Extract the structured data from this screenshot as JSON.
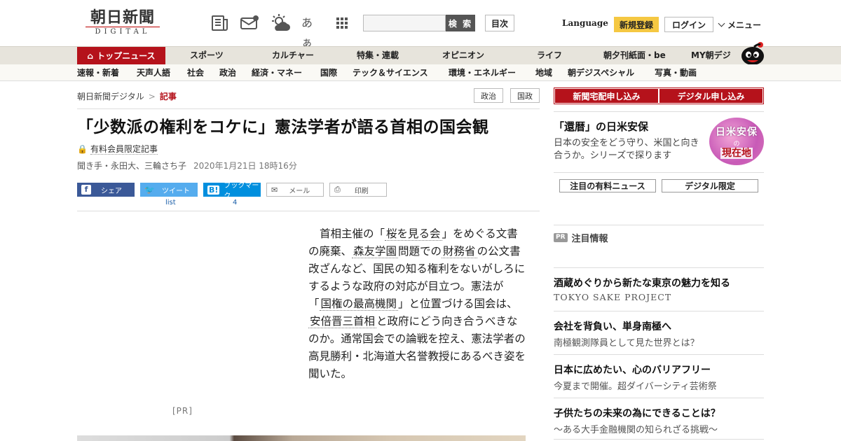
{
  "header": {
    "logo_main": "朝日新聞",
    "logo_sub": "DIGITAL",
    "icons": [
      "newspaper-icon",
      "mail-icon",
      "weather-icon",
      "font-size-icon",
      "grid-menu-icon"
    ],
    "font_icon_text": "あぁ",
    "search_placeholder": "",
    "search_button": "検 索",
    "toc_button": "目次",
    "language": "Language",
    "register": "新規登録",
    "login": "ログイン",
    "menu": "メニュー"
  },
  "nav_primary": {
    "home": "トップニュース",
    "items": [
      "スポーツ",
      "カルチャー",
      "特集・連載",
      "オピニオン",
      "ライフ",
      "朝夕刊紙面・be",
      "MY朝デジ"
    ]
  },
  "nav_secondary": {
    "items": [
      "速報・新着",
      "天声人語",
      "社会",
      "政治",
      "経済・マネー",
      "国際",
      "テック＆サイエンス",
      "環境・エネルギー",
      "地域",
      "朝デジスペシャル",
      "写真・動画"
    ]
  },
  "breadcrumb": {
    "site": "朝日新聞デジタル",
    "separator": ">",
    "current": "記事"
  },
  "tags": [
    "政治",
    "国政"
  ],
  "article": {
    "headline": "「少数派の権利をコケに」憲法学者が語る首相の国会観",
    "members_only": "有料会員限定記事",
    "byline": "聞き手・永田大、三輪さち子",
    "date": "2020年1月21日 18時16分",
    "lead": {
      "p1": "首相主催の「",
      "link1": "桜を見る会",
      "p2": "」をめぐる文書の廃棄、",
      "link2": "森友学園",
      "p3": "問題での",
      "link3": "財務省",
      "p4": "の公文書改ざんなど、国民の知る権利をないがしろにするような政府の対応が目立つ。憲法が「",
      "link4": "国権の最高機関",
      "p5": "」と位置づける国会は、",
      "link5": "安倍晋三首相",
      "p6": "と政府にどう向き合うべきなのか。通常国会での論戦を控え、憲法学者の高見勝利・北海道大名誉教授にあるべき姿を聞いた。"
    },
    "ad_label": "[PR]"
  },
  "share": {
    "facebook": "シェア",
    "twitter": "ツイート",
    "twitter_count": "list",
    "hatena": "ブックマーク",
    "hatena_count": "4",
    "mail": "メール",
    "print": "印刷"
  },
  "sidebar": {
    "subscribe_print": "新聞宅配申し込み",
    "subscribe_digital": "デジタル申し込み",
    "promo_title": "「還暦」の日米安保",
    "promo_desc": "日本の安全をどう守り、米国と向き合うか。シリーズで探ります",
    "badge_line1": "日米安保",
    "badge_line2": "の",
    "badge_line3": "現在地",
    "chip1": "注目の有料ニュース",
    "chip2": "デジタル限定",
    "pr_badge": "PR",
    "pr_head": "注目情報",
    "pr_items": [
      {
        "title": "酒蔵めぐりから新たな東京の魅力を知る",
        "sub": "TOKYO SAKE PROJECT"
      },
      {
        "title": "会社を背負い、単身南極へ",
        "sub": "南極観測隊員として見た世界とは？"
      },
      {
        "title": "日本に広めたい、心のバリアフリー",
        "sub": "今夏まで開催。超ダイバーシティ芸術祭"
      },
      {
        "title": "子供たちの未来の為にできることは？",
        "sub": "～ある大手金融機関の知られざる挑戦～"
      }
    ]
  },
  "colors": {
    "brand_red": "#b5121b",
    "register_yellow": "#f5c842",
    "facebook": "#3b5998",
    "twitter": "#55acee",
    "hatena": "#008fde"
  }
}
